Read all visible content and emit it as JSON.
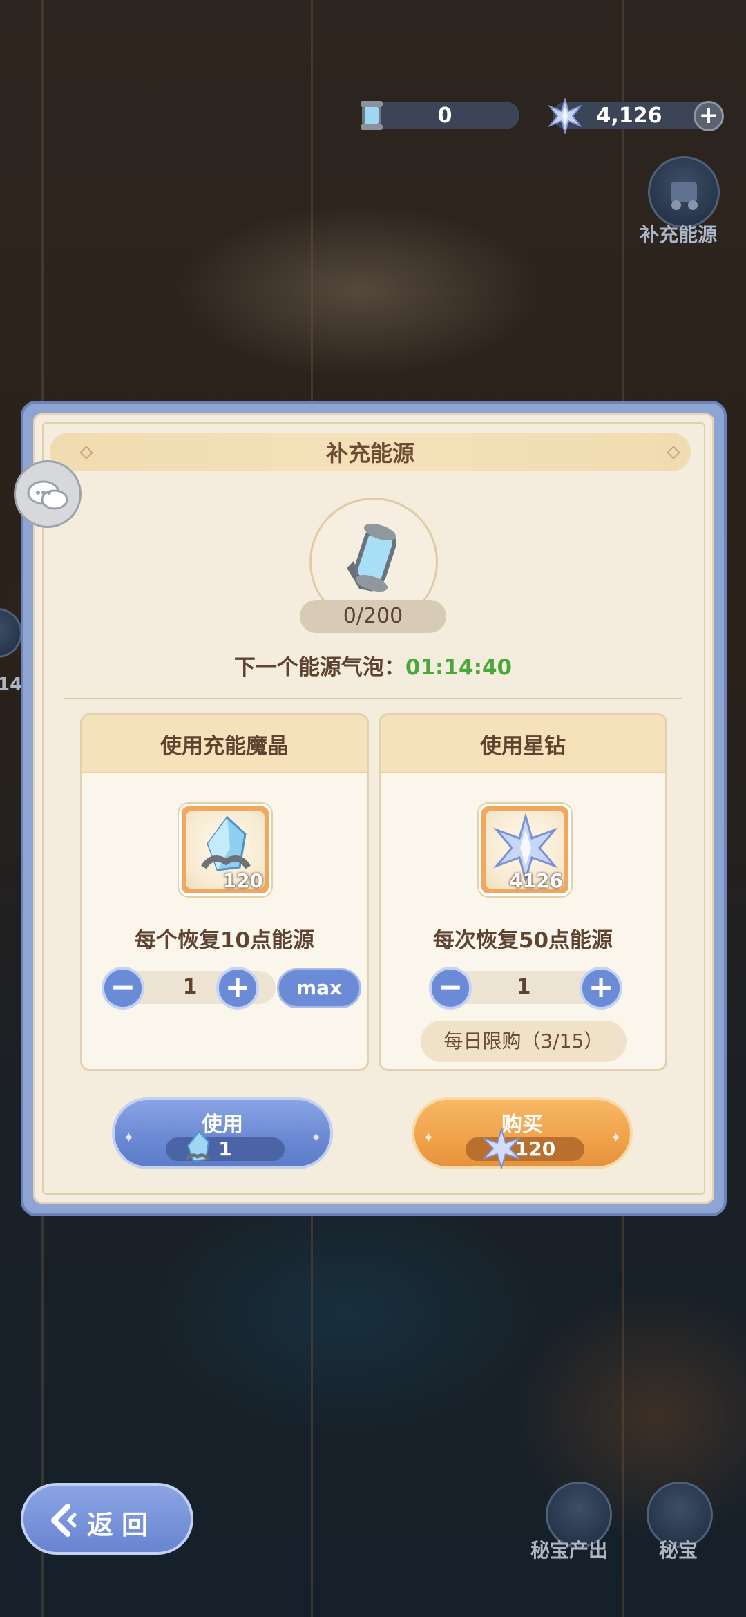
{
  "currency": {
    "energy_amount": "0",
    "star_diamond_amount": "4,126",
    "add_symbol": "+"
  },
  "side_buttons": {
    "refill_energy_label": "补充能源",
    "treasure_output_label": "秘宝产出",
    "treasure_label": "秘宝",
    "edge_number": "14"
  },
  "dialog": {
    "title": "补充能源",
    "energy_count": "0/200",
    "next_bubble_label": "下一个能源气泡：",
    "next_bubble_timer": "01:14:40",
    "crystal_card": {
      "title": "使用充能魔晶",
      "item_qty": "120",
      "recover_text": "每个恢复10点能源",
      "stepper_value": "1",
      "minus": "−",
      "plus": "+",
      "max_label": "max"
    },
    "diamond_card": {
      "title": "使用星钻",
      "item_qty": "4126",
      "recover_text": "每次恢复50点能源",
      "stepper_value": "1",
      "minus": "−",
      "plus": "+",
      "daily_limit": "每日限购（3/15）"
    },
    "use_button": {
      "label": "使用",
      "cost": "1"
    },
    "buy_button": {
      "label": "购买",
      "cost": "120"
    }
  },
  "back_button": {
    "label": "返回"
  },
  "colors": {
    "timer_green": "#4aa83a",
    "button_blue": "#6c8bd6",
    "button_orange": "#f0a24a",
    "panel_cream": "#f4ecdc"
  },
  "icons": [
    "energy-canister-icon",
    "star-diamond-icon",
    "plus-icon",
    "chat-icon",
    "crystal-icon",
    "back-arrow-icon"
  ]
}
